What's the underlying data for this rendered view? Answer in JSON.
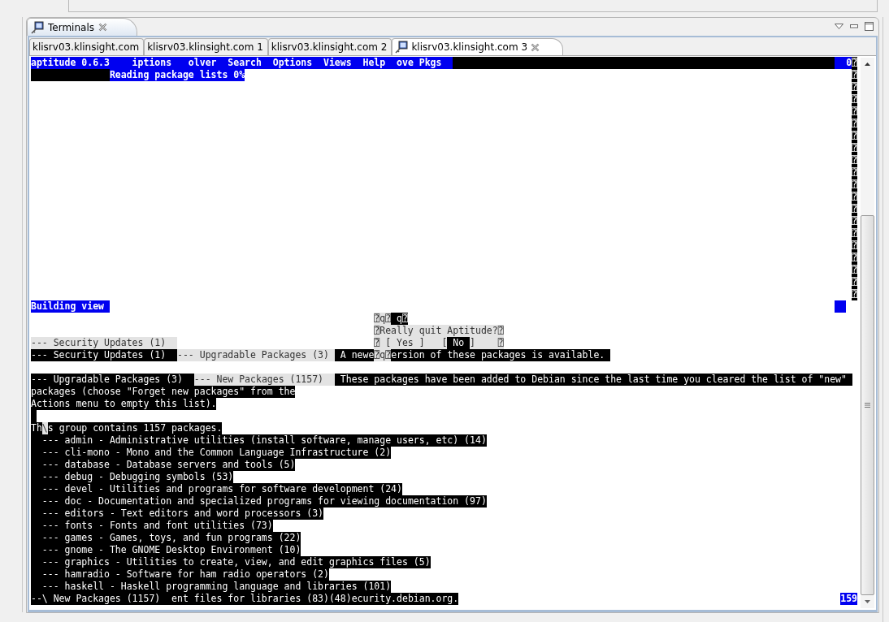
{
  "view_tab": {
    "label": "Terminals",
    "selected": true
  },
  "terminal_tabs": [
    {
      "label": "klisrv03.klinsight.com",
      "selected": false,
      "icon": false
    },
    {
      "label": "klisrv03.klinsight.com 1",
      "selected": false,
      "icon": false
    },
    {
      "label": "klisrv03.klinsight.com 2",
      "selected": false,
      "icon": false
    },
    {
      "label": "klisrv03.klinsight.com 3",
      "selected": true,
      "icon": true
    }
  ],
  "terminal_rows": [
    {
      "left": [
        {
          "kind": "menu",
          "text": "aptitude 0.6.3    iptions   olver  Search  Options  Views  Help  ove Pkgs  "
        },
        {
          "kind": "bar"
        }
      ],
      "right": [
        {
          "kind": "menu",
          "text": "  0"
        },
        {
          "kind": "inverse",
          "text": "⍰"
        }
      ]
    },
    {
      "left": [
        {
          "kind": "indent"
        },
        {
          "kind": "menu",
          "text": "Reading package lists 0%"
        }
      ],
      "right": [
        {
          "kind": "inverse",
          "text": "⍰"
        }
      ]
    },
    {
      "left": [],
      "right": [
        {
          "kind": "inverse",
          "text": "⍰"
        }
      ]
    },
    {
      "left": [],
      "right": [
        {
          "kind": "inverse",
          "text": "⍰"
        }
      ]
    },
    {
      "left": [],
      "right": [
        {
          "kind": "inverse",
          "text": "⍰"
        }
      ]
    },
    {
      "left": [],
      "right": [
        {
          "kind": "inverse",
          "text": "⍰"
        }
      ]
    },
    {
      "left": [],
      "right": [
        {
          "kind": "inverse",
          "text": "⍰"
        }
      ]
    },
    {
      "left": [],
      "right": [
        {
          "kind": "inverse",
          "text": "⍰"
        }
      ]
    },
    {
      "left": [],
      "right": [
        {
          "kind": "inverse",
          "text": "⍰"
        }
      ]
    },
    {
      "left": [],
      "right": [
        {
          "kind": "inverse",
          "text": "⍰"
        }
      ]
    },
    {
      "left": [],
      "right": [
        {
          "kind": "inverse",
          "text": "⍰"
        }
      ]
    },
    {
      "left": [],
      "right": [
        {
          "kind": "inverse",
          "text": "⍰"
        }
      ]
    },
    {
      "left": [],
      "right": [
        {
          "kind": "inverse",
          "text": "⍰"
        }
      ]
    },
    {
      "left": [],
      "right": [
        {
          "kind": "inverse",
          "text": "⍰"
        }
      ]
    },
    {
      "left": [],
      "right": [
        {
          "kind": "inverse",
          "text": "⍰"
        }
      ]
    },
    {
      "left": [],
      "right": [
        {
          "kind": "inverse",
          "text": "⍰"
        }
      ]
    },
    {
      "left": [],
      "right": [
        {
          "kind": "inverse",
          "text": "⍰"
        }
      ]
    },
    {
      "left": [],
      "right": [
        {
          "kind": "inverse",
          "text": "⍰"
        }
      ]
    },
    {
      "left": [],
      "right": [
        {
          "kind": "inverse",
          "text": "⍰"
        }
      ]
    },
    {
      "left": [],
      "right": [
        {
          "kind": "inverse",
          "text": "⍰"
        }
      ]
    },
    {
      "left": [
        {
          "kind": "menu",
          "text": "Building view "
        }
      ],
      "right": [
        {
          "kind": "block"
        }
      ]
    },
    {
      "left": [],
      "dialog": [
        {
          "kind": "dim",
          "text": "⍰q⍰"
        },
        {
          "kind": "inverse",
          "text": " q⍰"
        }
      ]
    },
    {
      "left": [],
      "dialog": [
        {
          "kind": "dim",
          "text": "⍰Really quit Aptitude?⍰"
        }
      ]
    },
    {
      "left": [
        {
          "kind": "dim",
          "text": "--- Security Updates (1)  "
        }
      ],
      "dialog": [
        {
          "kind": "dim",
          "text": "⍰ [ Yes ]   ["
        },
        {
          "kind": "inverse",
          "text": " No "
        },
        {
          "kind": "dim",
          "text": "]    ⍰"
        }
      ]
    },
    {
      "left": [
        {
          "kind": "inverse",
          "text": "--- Security Updates (1)  "
        },
        {
          "kind": "dim",
          "text": "--- Upgradable Packages (3) "
        },
        {
          "kind": "inverse",
          "text": " A newe"
        },
        {
          "kind": "dim",
          "text": "⍰q⍰"
        },
        {
          "kind": "inverse",
          "text": "ersion of these packages is available. "
        }
      ]
    },
    {
      "left": []
    },
    {
      "left": [
        {
          "kind": "inverse",
          "text": "--- Upgradable Packages (3)  "
        },
        {
          "kind": "dim",
          "text": "--- New Packages (1157)  "
        },
        {
          "kind": "inverse",
          "text": " These packages have been added to Debian since the last time you cleared the list of \"new\" "
        }
      ]
    },
    {
      "left": [
        {
          "kind": "inverse",
          "text": "packages (choose \"Forget new packages\" from the"
        }
      ]
    },
    {
      "left": [
        {
          "kind": "inverse",
          "text": "Actions menu to empty this list)."
        }
      ]
    },
    {
      "left": [
        {
          "kind": "cursor"
        }
      ]
    },
    {
      "left": [
        {
          "kind": "inverse",
          "text": "Th"
        },
        {
          "kind": "dim",
          "text": "\\"
        },
        {
          "kind": "inverse",
          "text": "s group contains 1157 packages."
        }
      ]
    },
    {
      "left": [
        {
          "kind": "inverse",
          "text": "  --- admin - Administrative utilities (install software, manage users, etc) (14)"
        }
      ]
    },
    {
      "left": [
        {
          "kind": "inverse",
          "text": "  --- cli-mono - Mono and the Common Language Infrastructure (2)"
        }
      ]
    },
    {
      "left": [
        {
          "kind": "inverse",
          "text": "  --- database - Database servers and tools (5)"
        }
      ]
    },
    {
      "left": [
        {
          "kind": "inverse",
          "text": "  --- debug - Debugging symbols (53)"
        }
      ]
    },
    {
      "left": [
        {
          "kind": "inverse",
          "text": "  --- devel - Utilities and programs for software development (24)"
        }
      ]
    },
    {
      "left": [
        {
          "kind": "inverse",
          "text": "  --- doc - Documentation and specialized programs for viewing documentation (97)"
        }
      ]
    },
    {
      "left": [
        {
          "kind": "inverse",
          "text": "  --- editors - Text editors and word processors (3)"
        }
      ]
    },
    {
      "left": [
        {
          "kind": "inverse",
          "text": "  --- fonts - Fonts and font utilities (73)"
        }
      ]
    },
    {
      "left": [
        {
          "kind": "inverse",
          "text": "  --- games - Games, toys, and fun programs (22)"
        }
      ]
    },
    {
      "left": [
        {
          "kind": "inverse",
          "text": "  --- gnome - The GNOME Desktop Environment (10)"
        }
      ]
    },
    {
      "left": [
        {
          "kind": "inverse",
          "text": "  --- graphics - Utilities to create, view, and edit graphics files (5)"
        }
      ]
    },
    {
      "left": [
        {
          "kind": "inverse",
          "text": "  --- hamradio - Software for ham radio operators (2)"
        }
      ]
    },
    {
      "left": [
        {
          "kind": "inverse",
          "text": "  --- haskell - Haskell programming language and libraries (101)"
        }
      ]
    },
    {
      "left": [
        {
          "kind": "inverse",
          "text": "--\\ New Packages (1157)  ent files for libraries (83)(48)ecurity.debian.org."
        }
      ],
      "right": [
        {
          "kind": "menu",
          "text": "159"
        }
      ]
    }
  ]
}
